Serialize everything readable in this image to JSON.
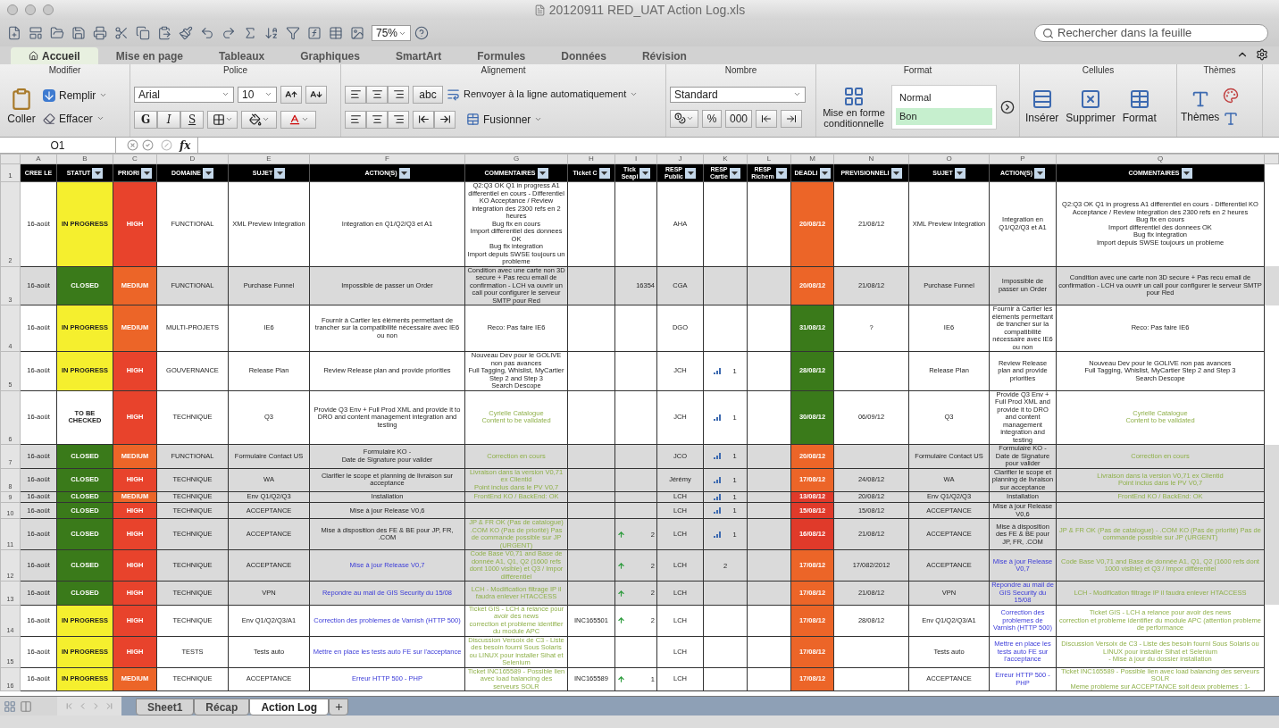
{
  "window": {
    "title": "20120911 RED_UAT Action Log.xls"
  },
  "toolbar": {
    "zoom": "75%",
    "search_placeholder": "Rechercher dans la feuille"
  },
  "ribbon_tabs": [
    {
      "label": "Accueil",
      "selected": true
    },
    {
      "label": "Mise en page",
      "selected": false
    },
    {
      "label": "Tableaux",
      "selected": false
    },
    {
      "label": "Graphiques",
      "selected": false
    },
    {
      "label": "SmartArt",
      "selected": false
    },
    {
      "label": "Formules",
      "selected": false
    },
    {
      "label": "Données",
      "selected": false
    },
    {
      "label": "Révision",
      "selected": false
    }
  ],
  "ribbon": {
    "modifier": {
      "title": "Modifier",
      "paste": "Coller",
      "fill": "Remplir",
      "clear": "Effacer"
    },
    "police": {
      "title": "Police",
      "font": "Arial",
      "size": "10",
      "bold": "G",
      "italic": "I",
      "underline": "S"
    },
    "alignement": {
      "title": "Alignement",
      "orientation": "abc",
      "wrap": "Renvoyer à la ligne automatiquement",
      "merge": "Fusionner"
    },
    "nombre": {
      "title": "Nombre",
      "format": "Standard",
      "percent": "%",
      "thousands": "000"
    },
    "format": {
      "title": "Format",
      "conditional": "Mise en forme conditionnelle",
      "styles": [
        {
          "label": "Normal",
          "color": "#ffffff"
        },
        {
          "label": "Bon",
          "color": "#c6efce"
        }
      ]
    },
    "cellules": {
      "title": "Cellules",
      "insert": "Insérer",
      "delete": "Supprimer",
      "format": "Format"
    },
    "themes": {
      "title": "Thèmes",
      "themes": "Thèmes"
    }
  },
  "formula_bar": {
    "cell": "O1",
    "function_label": "fx"
  },
  "column_letters": [
    "A",
    "B",
    "C",
    "D",
    "E",
    "F",
    "G",
    "H",
    "I",
    "J",
    "K",
    "L",
    "M",
    "N",
    "O",
    "P",
    "Q"
  ],
  "headers": [
    {
      "label": "CREE LE",
      "filter": false
    },
    {
      "label": "STATUT",
      "filter": true
    },
    {
      "label": "PRIORI",
      "filter": true
    },
    {
      "label": "DOMAINE",
      "filter": true
    },
    {
      "label": "SUJET",
      "filter": true
    },
    {
      "label": "ACTION(S)",
      "filter": true
    },
    {
      "label": "COMMENTAIRES",
      "filter": true
    },
    {
      "label": "Ticket C",
      "filter": true
    },
    {
      "label": "Tick\nSeapi",
      "filter": true
    },
    {
      "label": "RESP\nPublic",
      "filter": true
    },
    {
      "label": "RESP\nCartie",
      "filter": true
    },
    {
      "label": "RESP\nRichem",
      "filter": true
    },
    {
      "label": "DEADLI",
      "filter": true
    },
    {
      "label": "PREVISIONNELI",
      "filter": true
    },
    {
      "label": "SUJET",
      "filter": true
    },
    {
      "label": "ACTION(S)",
      "filter": true
    },
    {
      "label": "COMMENTAIRES",
      "filter": true
    }
  ],
  "header_row_number": "1",
  "rows": [
    {
      "num": "2",
      "shaded": false,
      "created": "16-août",
      "status": {
        "text": "IN PROGRESS",
        "color": "#f5ef2e"
      },
      "priority": {
        "text": "HIGH",
        "color": "#e8432c"
      },
      "domain": "FUNCTIONAL",
      "subject": "XML Preview Integration",
      "action": {
        "text": "Integration en Q1/Q2/Q3 et A1",
        "kind": "plain"
      },
      "comment": {
        "text": "Q2:Q3 OK Q1 in progress A1 differentiel en cours - Differentiel KO Acceptance / Review integration des 2300 refs en 2 heures\nBug fix en cours\nImport differentiel des donnees OK\nBug fix integration\nImport depuis SWSE toujours un probleme",
        "kind": "plain"
      },
      "seapi": {
        "arrow": false
      },
      "resp_public": "AHA",
      "resp_cartier": {
        "bars": false
      },
      "deadline": {
        "text": "20/08/12",
        "color": "#ec6528"
      },
      "forecast": "21/08/12",
      "subject2": "XML Preview Integration",
      "action2": {
        "text": "Integration en Q1/Q2/Q3 et A1",
        "kind": "plain"
      },
      "comment2": {
        "text": "Q2:Q3 OK Q1 in progress A1 differentiel en cours - Differentiel KO Acceptance / Review integration des 2300 refs en 2 heures\nBug fix en cours\nImport differentiel des donnees OK\nBug fix integration\nImport depuis SWSE toujours un probleme",
        "kind": "plain"
      }
    },
    {
      "num": "3",
      "shaded": true,
      "created": "16-août",
      "status": {
        "text": "CLOSED",
        "color": "#3a7a1a"
      },
      "priority": {
        "text": "MEDIUM",
        "color": "#ec6528"
      },
      "domain": "FUNCTIONAL",
      "subject": "Purchase Funnel",
      "action": {
        "text": "Impossible de passer un Order",
        "kind": "plain"
      },
      "comment": {
        "text": "Condition avec une carte non 3D secure + Pas recu email de confirmation - LCH va ouvrir un call pour configurer le serveur SMTP pour Red",
        "kind": "plain"
      },
      "seapi": {
        "text": "16354",
        "arrow": false
      },
      "resp_public": "CGA",
      "resp_cartier": {
        "bars": false
      },
      "deadline": {
        "text": "20/08/12",
        "color": "#ec6528"
      },
      "forecast": "21/08/12",
      "subject2": "Purchase Funnel",
      "action2": {
        "text": "Impossible de passer un Order",
        "kind": "plain"
      },
      "comment2": {
        "text": "Condition avec une carte non 3D secure + Pas recu email de confirmation - LCH va ouvrir un call pour configurer le serveur SMTP pour Red",
        "kind": "plain"
      }
    },
    {
      "num": "4",
      "shaded": false,
      "created": "16-août",
      "status": {
        "text": "IN PROGRESS",
        "color": "#f5ef2e"
      },
      "priority": {
        "text": "MEDIUM",
        "color": "#ec6528"
      },
      "domain": "MULTI-PROJETS",
      "subject": "IE6",
      "action": {
        "text": "Fournir à Cartier les éléments permettant de trancher sur la compatibilité nécessaire avec IE6 ou non",
        "kind": "plain"
      },
      "comment": {
        "text": "Reco: Pas faire IE6",
        "kind": "plain"
      },
      "seapi": {
        "arrow": false
      },
      "resp_public": "DGO",
      "resp_cartier": {
        "bars": false
      },
      "deadline": {
        "text": "31/08/12",
        "color": "#3a7a1a"
      },
      "forecast": "?",
      "subject2": "IE6",
      "action2": {
        "text": "Fournir à Cartier les éléments permettant de trancher sur la compatibilité nécessaire avec IE6 ou non",
        "kind": "plain"
      },
      "comment2": {
        "text": "Reco: Pas faire IE6",
        "kind": "plain"
      }
    },
    {
      "num": "5",
      "shaded": false,
      "created": "16-août",
      "status": {
        "text": "IN PROGRESS",
        "color": "#f5ef2e"
      },
      "priority": {
        "text": "HIGH",
        "color": "#e8432c"
      },
      "domain": "GOUVERNANCE",
      "subject": "Release Plan",
      "action": {
        "text": "Review Release plan and provide priorities",
        "kind": "plain"
      },
      "comment": {
        "text": "Nouveau Dev pour le GOLIVE non pas avances\nFull Tagging,  Whislist, MyCartier Step 2 and Step 3\nSearch Descope",
        "kind": "plain"
      },
      "seapi": {
        "arrow": false
      },
      "resp_public": "JCH",
      "resp_cartier": {
        "text": "1",
        "bars": true
      },
      "deadline": {
        "text": "28/08/12",
        "color": "#3a7a1a"
      },
      "subject2": "Release Plan",
      "action2": {
        "text": "Review Release plan and provide priorities",
        "kind": "plain"
      },
      "comment2": {
        "text": "Nouveau Dev pour le GOLIVE non pas avances\nFull Tagging,  Whislist, MyCartier Step 2 and Step 3\nSearch Descope",
        "kind": "plain"
      }
    },
    {
      "num": "6",
      "shaded": false,
      "created": "16-août",
      "status": {
        "text": "TO BE CHECKED",
        "color": "#ffffff"
      },
      "priority": {
        "text": "HIGH",
        "color": "#e8432c"
      },
      "domain": "TECHNIQUE",
      "subject": "Q3",
      "action": {
        "text": "Provide Q3 Env + Full Prod XML and provide it to DRO and content management integration and testing",
        "kind": "plain"
      },
      "comment": {
        "text": "Cyrielle Catalogue\nContent to be validated",
        "kind": "note"
      },
      "seapi": {
        "arrow": false
      },
      "resp_public": "JCH",
      "resp_cartier": {
        "text": "1",
        "bars": true
      },
      "deadline": {
        "text": "30/08/12",
        "color": "#3a7a1a"
      },
      "forecast": "06/09/12",
      "subject2": "Q3",
      "action2": {
        "text": "Provide Q3 Env + Full Prod XML and provide it to DRO and content management integration and testing",
        "kind": "plain"
      },
      "comment2": {
        "text": "Cyrielle Catalogue\nContent to be validated",
        "kind": "note"
      }
    },
    {
      "num": "7",
      "shaded": true,
      "created": "16-août",
      "status": {
        "text": "CLOSED",
        "color": "#3a7a1a"
      },
      "priority": {
        "text": "MEDIUM",
        "color": "#ec6528"
      },
      "domain": "FUNCTIONAL",
      "subject": "Formulaire Contact US",
      "action": {
        "text": "Formulaire KO -\nDate de Signature pour valider",
        "kind": "plain"
      },
      "comment": {
        "text": "Correction en cours",
        "kind": "note"
      },
      "seapi": {
        "arrow": false
      },
      "resp_public": "JCO",
      "resp_cartier": {
        "text": "1",
        "bars": true
      },
      "deadline": {
        "text": "20/08/12",
        "color": "#ec6528"
      },
      "subject2": "Formulaire Contact US",
      "action2": {
        "text": "Formulaire KO - Date de Signature pour valider",
        "kind": "plain"
      },
      "comment2": {
        "text": "Correction en cours",
        "kind": "note"
      }
    },
    {
      "num": "8",
      "shaded": true,
      "created": "16-août",
      "status": {
        "text": "CLOSED",
        "color": "#3a7a1a"
      },
      "priority": {
        "text": "HIGH",
        "color": "#e8432c"
      },
      "domain": "TECHNIQUE",
      "subject": "WA",
      "action": {
        "text": "Clarifier le scope et planning de livraison sur acceptance",
        "kind": "plain"
      },
      "comment": {
        "text": "Livraison dans la version V0,71 ex Clientid\nPoint inclus dans le PV V0,7",
        "kind": "note"
      },
      "seapi": {
        "arrow": false
      },
      "resp_public": "Jérémy",
      "resp_cartier": {
        "text": "1",
        "bars": true
      },
      "deadline": {
        "text": "17/08/12",
        "color": "#ec6528"
      },
      "forecast": "24/08/12",
      "subject2": "WA",
      "action2": {
        "text": "Clarifier le scope et planning de livraison sur acceptance",
        "kind": "plain"
      },
      "comment2": {
        "text": "Livraison dans la version V0,71 ex Clientid\nPoint inclus dans le PV V0,7",
        "kind": "note"
      }
    },
    {
      "num": "9",
      "shaded": true,
      "created": "16-août",
      "status": {
        "text": "CLOSED",
        "color": "#3a7a1a"
      },
      "priority": {
        "text": "MEDIUM",
        "color": "#ec6528"
      },
      "domain": "TECHNIQUE",
      "subject": "Env Q1/Q2/Q3",
      "action": {
        "text": "Installation",
        "kind": "plain"
      },
      "comment": {
        "text": "FrontEnd KO / BackEnd: OK",
        "kind": "note"
      },
      "seapi": {
        "arrow": false
      },
      "resp_public": "LCH",
      "resp_cartier": {
        "text": "1",
        "bars": true
      },
      "deadline": {
        "text": "13/08/12",
        "color": "#e03a2a"
      },
      "forecast": "20/08/12",
      "subject2": "Env Q1/Q2/Q3",
      "action2": {
        "text": "Installation",
        "kind": "plain"
      },
      "comment2": {
        "text": "FrontEnd KO / BackEnd: OK",
        "kind": "note"
      }
    },
    {
      "num": "10",
      "shaded": true,
      "created": "16-août",
      "status": {
        "text": "CLOSED",
        "color": "#3a7a1a"
      },
      "priority": {
        "text": "HIGH",
        "color": "#e8432c"
      },
      "domain": "TECHNIQUE",
      "subject": "ACCEPTANCE",
      "action": {
        "text": "Mise à jour Release V0,6",
        "kind": "plain"
      },
      "seapi": {
        "arrow": false
      },
      "resp_public": "LCH",
      "resp_cartier": {
        "text": "1",
        "bars": true
      },
      "deadline": {
        "text": "15/08/12",
        "color": "#e03a2a"
      },
      "forecast": "15/08/12",
      "subject2": "ACCEPTANCE",
      "action2": {
        "text": "Mise à jour Release V0,6",
        "kind": "plain"
      }
    },
    {
      "num": "11",
      "shaded": true,
      "created": "16-août",
      "status": {
        "text": "CLOSED",
        "color": "#3a7a1a"
      },
      "priority": {
        "text": "HIGH",
        "color": "#e8432c"
      },
      "domain": "TECHNIQUE",
      "subject": "ACCEPTANCE",
      "action": {
        "text": "Mise à disposition des FE & BE pour JP, FR, .COM",
        "kind": "plain"
      },
      "comment": {
        "text": "JP & FR OK (Pas de catalogue) .COM KO (Pas de priorité) Pas de commande possible sur JP (URGENT)",
        "kind": "note"
      },
      "seapi": {
        "text": "2",
        "arrow": true
      },
      "resp_public": "LCH",
      "resp_cartier": {
        "text": "1",
        "bars": true
      },
      "deadline": {
        "text": "16/08/12",
        "color": "#e03a2a"
      },
      "forecast": "21/08/12",
      "subject2": "ACCEPTANCE",
      "action2": {
        "text": "Mise à disposition des FE & BE pour JP, FR, .COM",
        "kind": "plain"
      },
      "comment2": {
        "text": "JP & FR OK (Pas de catalogue) - .COM KO (Pas de priorité) Pas de commande possible sur JP (URGENT)",
        "kind": "note"
      }
    },
    {
      "num": "12",
      "shaded": true,
      "created": "16-août",
      "status": {
        "text": "CLOSED",
        "color": "#3a7a1a"
      },
      "priority": {
        "text": "HIGH",
        "color": "#e8432c"
      },
      "domain": "TECHNIQUE",
      "subject": "ACCEPTANCE",
      "action": {
        "text": "Mise à jour Release V0,7",
        "kind": "link"
      },
      "comment": {
        "text": "Code Base V0,71 and Base de donnée A1, Q1, Q2 (1600 refs dont 1000 visible) et Q3 / Impor différentiel",
        "kind": "note"
      },
      "seapi": {
        "text": "2",
        "arrow": true
      },
      "resp_public": "LCH",
      "resp_cartier": {
        "text": "2",
        "bars": false
      },
      "deadline": {
        "text": "17/08/12",
        "color": "#ec6528"
      },
      "forecast": "17/082/2012",
      "subject2": "ACCEPTANCE",
      "action2": {
        "text": "Mise à jour Release V0,7",
        "kind": "link"
      },
      "comment2": {
        "text": "Code Base V0,71 and Base de donnée A1, Q1, Q2 (1600 refs dont 1000 visible) et Q3 / Impor différentiel",
        "kind": "note"
      }
    },
    {
      "num": "13",
      "shaded": true,
      "created": "16-août",
      "status": {
        "text": "CLOSED",
        "color": "#3a7a1a"
      },
      "priority": {
        "text": "HIGH",
        "color": "#e8432c"
      },
      "domain": "TECHNIQUE",
      "subject": "VPN",
      "action": {
        "text": "Repondre au mail de GIS Security du 15/08",
        "kind": "link"
      },
      "comment": {
        "text": "LCH - Modification filtrage IP il faudra enlever HTACCESS",
        "kind": "note"
      },
      "seapi": {
        "text": "2",
        "arrow": true
      },
      "resp_public": "LCH",
      "resp_cartier": {
        "bars": false
      },
      "deadline": {
        "text": "17/08/12",
        "color": "#ec6528"
      },
      "forecast": "21/08/12",
      "subject2": "VPN",
      "action2": {
        "text": "Repondre au mail de GIS Security du 15/08",
        "kind": "link"
      },
      "comment2": {
        "text": "LCH - Modification filtrage IP il faudra enlever HTACCESS",
        "kind": "note"
      }
    },
    {
      "num": "14",
      "shaded": false,
      "created": "16-août",
      "status": {
        "text": "IN PROGRESS",
        "color": "#f5ef2e"
      },
      "priority": {
        "text": "HIGH",
        "color": "#e8432c"
      },
      "domain": "TECHNIQUE",
      "subject": "Env Q1/Q2/Q3/A1",
      "action": {
        "text": "Correction des problemes de Varnish (HTTP 500)",
        "kind": "link"
      },
      "comment": {
        "text": "Ticket GIS - LCH a relance pour avoir des news\ncorrection et probleme identifier du module APC",
        "kind": "note"
      },
      "ticket": "INC165501",
      "seapi": {
        "text": "2",
        "arrow": true
      },
      "resp_public": "LCH",
      "resp_cartier": {
        "bars": false
      },
      "deadline": {
        "text": "17/08/12",
        "color": "#ec6528"
      },
      "forecast": "28/08/12",
      "subject2": "Env Q1/Q2/Q3/A1",
      "action2": {
        "text": "Correction des problemes de Varnish (HTTP 500)",
        "kind": "link"
      },
      "comment2": {
        "text": "Ticket GIS - LCH a relance pour avoir des news\ncorrection et probleme identifier du module APC (attention probleme de performance",
        "kind": "note"
      }
    },
    {
      "num": "15",
      "shaded": false,
      "created": "16-août",
      "status": {
        "text": "IN PROGRESS",
        "color": "#f5ef2e"
      },
      "priority": {
        "text": "HIGH",
        "color": "#e8432c"
      },
      "domain": "TESTS",
      "subject": "Tests auto",
      "action": {
        "text": "Mettre en place les tests auto FE sur l'acceptance",
        "kind": "link"
      },
      "comment": {
        "text": "Discussion Versoix de C3 - Liste des besoin fourni Sous Solaris ou LINUX pour installer Sihat et Selenium",
        "kind": "note"
      },
      "seapi": {
        "arrow": false
      },
      "resp_public": "LCH",
      "resp_cartier": {
        "bars": false
      },
      "deadline": {
        "text": "17/08/12",
        "color": "#ec6528"
      },
      "subject2": "Tests auto",
      "action2": {
        "text": "Mettre en place les tests auto FE sur l'acceptance",
        "kind": "link"
      },
      "comment2": {
        "text": "Discussion Versoix de C3 - Liste des besoin fourni Sous Solaris ou LINUX pour installer Sihat et Selenium\n- Mise à jour du dossier installation",
        "kind": "note"
      }
    },
    {
      "num": "16",
      "shaded": false,
      "created": "16-août",
      "status": {
        "text": "IN PROGRESS",
        "color": "#f5ef2e"
      },
      "priority": {
        "text": "MEDIUM",
        "color": "#ec6528"
      },
      "domain": "TECHNIQUE",
      "subject": "ACCEPTANCE",
      "action": {
        "text": "Erreur HTTP 500 - PHP",
        "kind": "link"
      },
      "comment": {
        "text": "Ticket INC165589 - Possible lien avec load balancing des serveurs SOLR",
        "kind": "note"
      },
      "ticket": "INC165589",
      "seapi": {
        "text": "1",
        "arrow": true
      },
      "resp_public": "LCH",
      "resp_cartier": {
        "bars": false
      },
      "deadline": {
        "text": "17/08/12",
        "color": "#ec6528"
      },
      "subject2": "ACCEPTANCE",
      "action2": {
        "text": "Erreur HTTP 500 - PHP",
        "kind": "link"
      },
      "comment2": {
        "text": "Ticket INC165589 - Possible lien avec load balancing des serveurs SOLR\nMeme probleme sur ACCEPTANCE soit deux problemes : 1-",
        "kind": "note"
      }
    }
  ],
  "sheet_tabs": [
    {
      "label": "Sheet1",
      "selected": false
    },
    {
      "label": "Récap",
      "selected": false
    },
    {
      "label": "Action Log",
      "selected": true
    }
  ]
}
